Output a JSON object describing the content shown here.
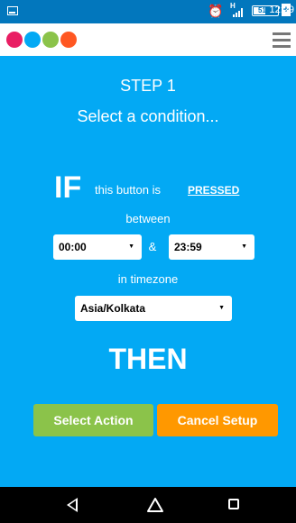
{
  "status_bar": {
    "time": "12:29",
    "battery_percent": "51%",
    "battery_level": 0.51,
    "network_type": "H",
    "icons": [
      "screenshot-icon",
      "alarm-icon",
      "signal-icon",
      "battery-icon"
    ]
  },
  "header": {
    "logo_colors": [
      "#e91e63",
      "#03a9f4",
      "#8bc34a",
      "#ff5722"
    ],
    "menu_icon": "hamburger-menu-icon"
  },
  "main": {
    "step_title": "STEP 1",
    "step_subtitle": "Select a condition...",
    "if_word": "IF",
    "if_text": "this button is",
    "if_state": "PRESSED",
    "between_text": "between",
    "start_time": "00:00",
    "amp": "&",
    "end_time": "23:59",
    "timezone_text": "in timezone",
    "timezone": "Asia/Kolkata",
    "then_word": "THEN",
    "select_action_label": "Select Action",
    "cancel_setup_label": "Cancel Setup",
    "colors": {
      "background": "#03a9f4",
      "select_action": "#8bc34a",
      "cancel_setup": "#ff9800"
    }
  },
  "nav_bar": {
    "icons": [
      "back-icon",
      "home-icon",
      "recents-icon"
    ]
  }
}
